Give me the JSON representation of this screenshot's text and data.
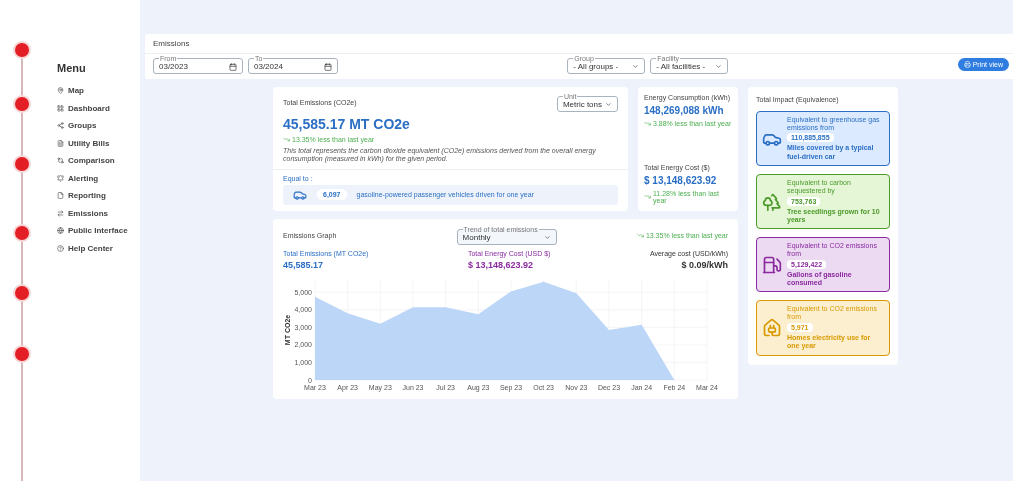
{
  "sidebar": {
    "title": "Menu",
    "items": [
      {
        "label": "Map"
      },
      {
        "label": "Dashboard"
      },
      {
        "label": "Groups"
      },
      {
        "label": "Utility Bills"
      },
      {
        "label": "Comparison"
      },
      {
        "label": "Alerting"
      },
      {
        "label": "Reporting"
      },
      {
        "label": "Emissions"
      },
      {
        "label": "Public Interface"
      },
      {
        "label": "Help Center"
      }
    ]
  },
  "header": {
    "title": "Emissions",
    "filters": [
      {
        "kind": "date",
        "label": "From",
        "value": "03/2023"
      },
      {
        "kind": "date",
        "label": "To",
        "value": "03/2024"
      },
      {
        "kind": "select",
        "label": "Group",
        "value": "- All groups -"
      },
      {
        "kind": "select",
        "label": "Facility",
        "value": "- All facilities -"
      }
    ],
    "print_button": "Print view"
  },
  "total_emissions": {
    "title": "Total Emissions (CO2e)",
    "unit_label": "Unit",
    "unit_value": "Metric tons",
    "value": "45,585.17 MT CO2e",
    "trend": "13.35% less than last year",
    "description": "This total represents the carbon dioxide equivalent (CO2e) emissions derived from the overall energy consumption (measured in kWh) for the given period.",
    "equal_label": "Equal to :",
    "equal_count": "6,097",
    "equal_text": "gasoline-powered passenger vehicles driven for one year"
  },
  "energy": [
    {
      "title": "Energy Consumption (kWh)",
      "value": "148,269,088 kWh",
      "trend": "3.88% less than last year"
    },
    {
      "title": "Total Energy Cost ($)",
      "value": "$ 13,148,623.92",
      "trend": "11.28% less than last year"
    }
  ],
  "graph": {
    "title": "Emissions Graph",
    "trend_label": "Trend of total emissions",
    "trend_value": "Monthly",
    "trend_note": "13.35% less than last year",
    "stats": [
      {
        "label": "Total Emissions (MT CO2e)",
        "value": "45,585.17",
        "color": "#2b6fc4"
      },
      {
        "label": "Total Energy Cost (USD $)",
        "value": "$ 13,148,623.92",
        "color": "#8a2a9e"
      },
      {
        "label": "Average cost (USD/kWh)",
        "value": "$ 0.09/kWh",
        "color": "#333333"
      }
    ],
    "chart_data": {
      "type": "area",
      "ylabel": "MT CO2e",
      "categories": [
        "Mar 23",
        "Apr 23",
        "May 23",
        "Jun 23",
        "Jul 23",
        "Aug 23",
        "Sep 23",
        "Oct 23",
        "Nov 23",
        "Dec 23",
        "Jan 24",
        "Feb 24",
        "Mar 24"
      ],
      "series": [
        {
          "color": "#bcd6f7",
          "values": [
            4750,
            3800,
            3200,
            4150,
            4150,
            3750,
            5050,
            5600,
            4950,
            2850,
            3150,
            0,
            null
          ]
        }
      ],
      "ylim": [
        0,
        5700
      ],
      "grid": true,
      "yticks": [
        0,
        {
          "value": 1000,
          "label": "1,000"
        },
        {
          "value": 2000,
          "label": "2,000"
        },
        {
          "value": 3000,
          "label": "3,000"
        },
        {
          "value": 4000,
          "label": "4,000"
        },
        {
          "value": 5000,
          "label": "5,000"
        }
      ]
    }
  },
  "impact": {
    "title": "Total Impact (Equivalence)",
    "items": [
      {
        "kind": "car",
        "color": "#2b6fc4",
        "caption": "Equivalent to greenhouse gas emissions from",
        "value": "110,885,855",
        "text": "Miles covered by a typical fuel-driven car"
      },
      {
        "kind": "tree",
        "color": "#4c9a2a",
        "caption": "Equivalent to carbon sequestered by",
        "value": "753,763",
        "text": "Tree seedlings grown for 10 years"
      },
      {
        "kind": "fuel",
        "color": "#8a2a9e",
        "caption": "Equivalent to CO2 emissions from",
        "value": "5,129,422",
        "text": "Gallons of gasoline consumed"
      },
      {
        "kind": "home",
        "color": "#d99a00",
        "caption": "Equivalent to CO2 emissions from",
        "value": "5,971",
        "text": "Homes electricity use for one year"
      }
    ]
  }
}
